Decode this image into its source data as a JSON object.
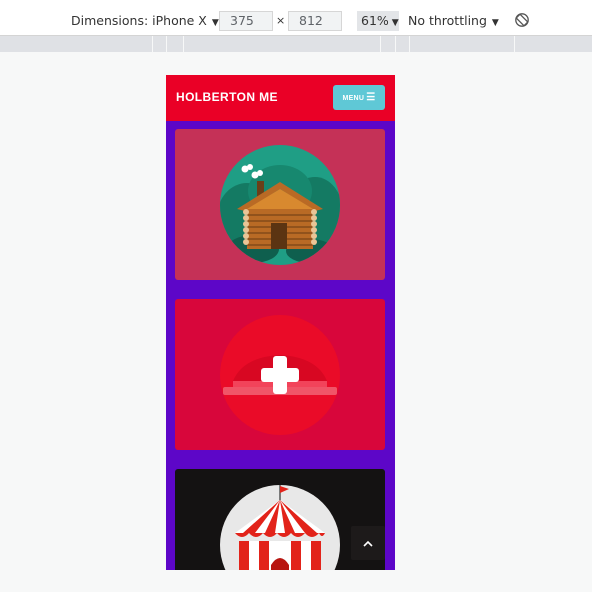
{
  "devtools": {
    "dimensions_label": "Dimensions: iPhone X",
    "width_value": "375",
    "times_sign": "×",
    "height_value": "812",
    "zoom": "61%",
    "throttling": "No throttling"
  },
  "site": {
    "title": "HOLBERTON ME",
    "menu_label": "MENU",
    "menu_bars": "☰"
  },
  "cards": [
    {
      "icon": "log-cabin-icon",
      "bg": "#c53157"
    },
    {
      "icon": "plus-icon",
      "bg": "#d8063b"
    },
    {
      "icon": "circus-tent-icon",
      "bg": "#141212"
    }
  ],
  "scroll_top_glyph": "⌃",
  "colors": {
    "header": "#ea0026",
    "menu_button": "#5fc8d6",
    "page_bg": "#5d06c8"
  }
}
